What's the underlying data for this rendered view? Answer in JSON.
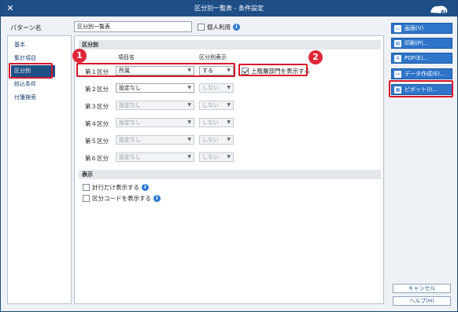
{
  "window": {
    "title": "区分別一覧表 - 条件設定",
    "close": "✕"
  },
  "pattern": {
    "label": "パターン名",
    "value": "区分別一覧表",
    "personal_label": "個人利用"
  },
  "sidebar": {
    "items": [
      {
        "label": "基本"
      },
      {
        "label": "集計項目"
      },
      {
        "label": "区分別"
      },
      {
        "label": "絞込条件"
      },
      {
        "label": "付箋検索"
      }
    ]
  },
  "main": {
    "section_title": "区分別",
    "columns": {
      "item": "項目名",
      "display": "区分別表示"
    },
    "rows": [
      {
        "label": "第１区分",
        "item": "所属",
        "display": "する"
      },
      {
        "label": "第２区分",
        "item": "設定なし",
        "display": "しない"
      },
      {
        "label": "第３区分",
        "item": "設定なし",
        "display": "しない"
      },
      {
        "label": "第４区分",
        "item": "設定なし",
        "display": "しない"
      },
      {
        "label": "第５区分",
        "item": "設定なし",
        "display": "しない"
      },
      {
        "label": "第６区分",
        "item": "設定なし",
        "display": "しない"
      }
    ],
    "upper_label": "上階層部門を表示する",
    "display_section_title": "表示",
    "display_options": [
      {
        "label": "計行だけ表示する"
      },
      {
        "label": "区分コードを表示する"
      }
    ]
  },
  "callouts": [
    {
      "number": "1"
    },
    {
      "number": "2"
    }
  ],
  "buttons": {
    "screen": "画面(V)",
    "print": "印刷(P)...",
    "pdf": "PDF(E)...",
    "data": "データ作成(E)...",
    "pivot": "ピボット(I)...",
    "cancel": "キャンセル",
    "help": "ヘルプ(H)"
  },
  "colors": {
    "accent": "#1e4e86",
    "button": "#2e74c9",
    "highlight": "#d9162a"
  }
}
